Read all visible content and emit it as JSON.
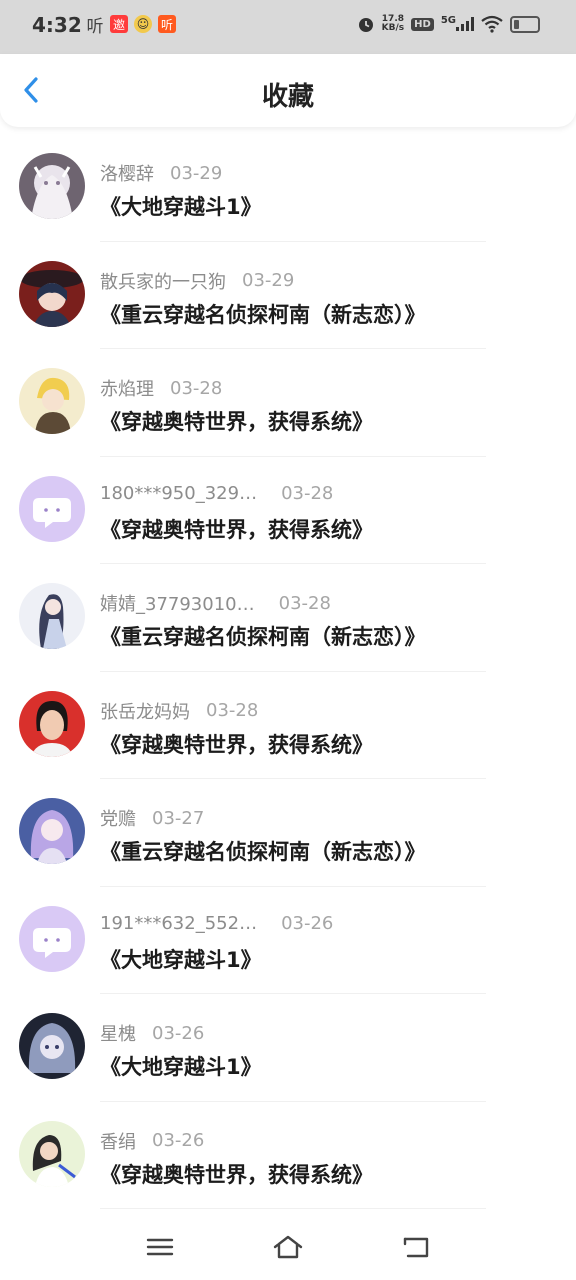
{
  "status_bar": {
    "time": "4:32",
    "left_icons": [
      {
        "icon": "ting-app-icon",
        "text": "听"
      },
      {
        "icon": "red-app-icon",
        "text": "邀"
      },
      {
        "icon": "emoji-app-icon",
        "text": "☺"
      },
      {
        "icon": "orange-ting-icon",
        "text": "听"
      }
    ],
    "net_speed_value": "17.8",
    "net_speed_unit": "KB/s",
    "hd_label": "HD",
    "network_label": "5G"
  },
  "header": {
    "title": "收藏"
  },
  "favorites": [
    {
      "username": "洛樱辞",
      "date": "03-29",
      "title": "《大地穿越斗1》",
      "avatar": "anime-white-hair"
    },
    {
      "username": "散兵家的一只狗",
      "date": "03-29",
      "title": "《重云穿越名侦探柯南（新志恋）》",
      "avatar": "anime-dark-hat"
    },
    {
      "username": "赤焰理",
      "date": "03-28",
      "title": "《穿越奥特世界，获得系统》",
      "avatar": "anime-blonde"
    },
    {
      "username": "180***950_329…",
      "date": "03-28",
      "title": "《穿越奥特世界，获得系统》",
      "avatar": "default-chat"
    },
    {
      "username": "婧婧_37793010…",
      "date": "03-28",
      "title": "《重云穿越名侦探柯南（新志恋）》",
      "avatar": "anime-kimono"
    },
    {
      "username": "张岳龙妈妈",
      "date": "03-28",
      "title": "《穿越奥特世界，获得系统》",
      "avatar": "photo-child"
    },
    {
      "username": "党赡",
      "date": "03-27",
      "title": "《重云穿越名侦探柯南（新志恋）》",
      "avatar": "anime-purple-hair"
    },
    {
      "username": "191***632_552…",
      "date": "03-26",
      "title": "《大地穿越斗1》",
      "avatar": "default-chat"
    },
    {
      "username": "星槐",
      "date": "03-26",
      "title": "《大地穿越斗1》",
      "avatar": "anime-dark-blue"
    },
    {
      "username": "香绢",
      "date": "03-26",
      "title": "《穿越奥特世界，获得系统》",
      "avatar": "photo-girl"
    }
  ],
  "colors": {
    "accent": "#2f8fe8",
    "status_bar_bg": "#d9d9d9",
    "default_avatar_bg": "#d9c9f5"
  }
}
